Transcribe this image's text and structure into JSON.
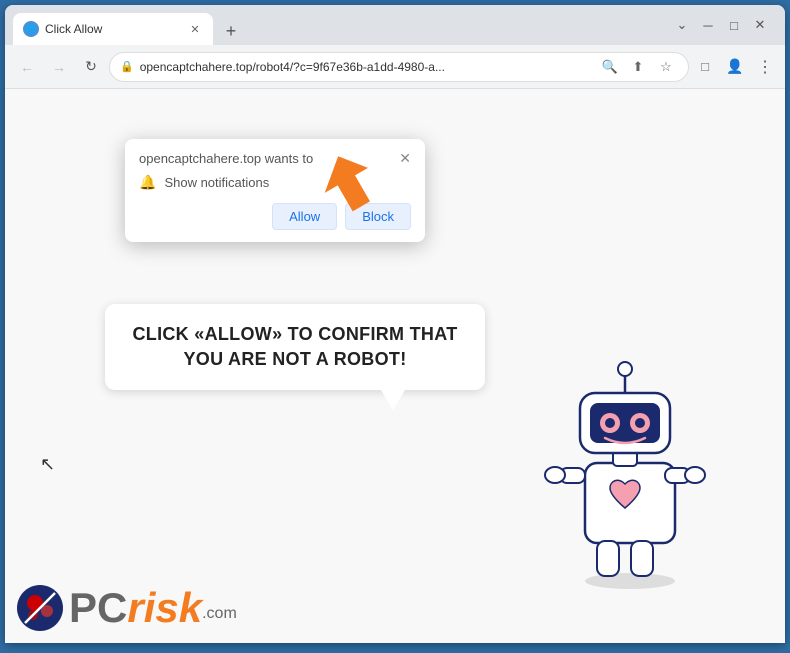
{
  "browser": {
    "tab": {
      "title": "Click Allow",
      "favicon": "🌐"
    },
    "new_tab_label": "+",
    "window_controls": {
      "minimize": "─",
      "maximize": "□",
      "close": "✕"
    },
    "address_bar": {
      "url": "opencaptchahere.top/robot4/?c=9f67e36b-a1dd-4980-a...",
      "lock_icon": "🔒"
    },
    "nav": {
      "back": "←",
      "forward": "→",
      "reload": "↻"
    }
  },
  "notification_popup": {
    "site_text": "opencaptchahere.top wants to",
    "notification_label": "Show notifications",
    "allow_label": "Allow",
    "block_label": "Block",
    "close_label": "✕"
  },
  "speech_bubble": {
    "text": "CLICK «ALLOW» TO CONFIRM THAT YOU ARE NOT A ROBOT!"
  },
  "logo": {
    "pc": "PC",
    "risk": "risk",
    "com": ".com"
  },
  "colors": {
    "brand_blue": "#2e6da4",
    "allow_blue": "#1a73e8",
    "arrow_orange": "#f47c20",
    "logo_orange": "#f47c20"
  }
}
